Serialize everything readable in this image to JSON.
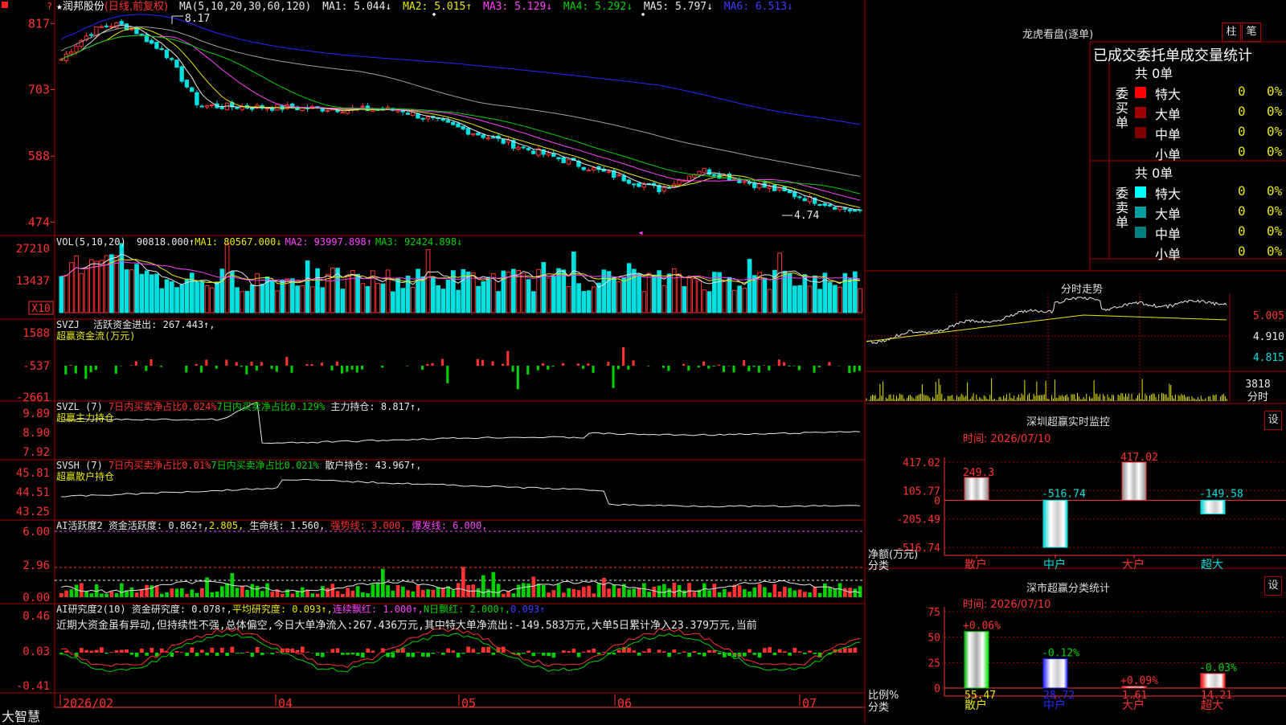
{
  "colors": {
    "up": "#ff3232",
    "down": "#00e0e0",
    "grid": "#a00000",
    "axis": "#ff3232",
    "white": "#e8e8e8",
    "yellow": "#e8e800",
    "magenta": "#ff40ff",
    "green": "#00d000",
    "gray": "#a0a0a0",
    "blue": "#2828ff"
  },
  "header": {
    "star": "★",
    "stock_name": "润邦股份",
    "period": "(日线,前复权)",
    "ma_label": "MA(5,10,20,30,60,120)",
    "ma1": "MA1: 5.044↓",
    "ma2": "MA2: 5.015↑",
    "ma3": "MA3: 5.129↓",
    "ma4": "MA4: 5.292↓",
    "ma5": "MA5: 5.797↓",
    "ma6": "MA6: 6.513↓"
  },
  "kline": {
    "yticks": [
      "817",
      "703",
      "588",
      "474"
    ],
    "high_label": "8.17",
    "low_label": "4.74",
    "top_left_mark": "?"
  },
  "vol": {
    "label": "VOL(5,10,20)",
    "value": "90818.000↑",
    "ma1": "MA1: 80567.000↓",
    "ma2": "MA2: 93997.898↑",
    "ma3": "MA3: 92424.898↓",
    "yticks": [
      "27210",
      "13437"
    ],
    "unit": "X10"
  },
  "svzj": {
    "label": "SVZJ",
    "name": "活跃资金进出: 267.443↑,",
    "sub": "超赢资金流(万元)",
    "yticks": [
      "1588",
      "-537",
      "-2661"
    ]
  },
  "svzl": {
    "label": "SVZL (7)",
    "t1": "7日内买卖净占比0.024%",
    "t2": "7日内买卖净占比0.129%",
    "t3": "主力持仓: 8.817↑,",
    "sub": "超赢主力持仓",
    "yticks": [
      "9.89",
      "8.90",
      "7.92"
    ]
  },
  "svsh": {
    "label": "SVSH (7)",
    "t1": "7日内买卖净占比0.01%",
    "t2": "7日内买卖净占比0.021%",
    "t3": "散户持仓: 43.967↑,",
    "sub": "超赢散户持仓",
    "yticks": [
      "45.81",
      "44.51",
      "43.25"
    ]
  },
  "ai1": {
    "label": "AI活跃度2",
    "t1": "资金活跃度: 0.862↑,",
    "t2": "2.805,",
    "t3": "生命线: 1.560,",
    "t4": "强势线: 3.000,",
    "t5": "爆发线: 6.000,",
    "yticks": [
      "6.00",
      "2.96",
      "0.00"
    ]
  },
  "ai2": {
    "label": "AI研究度2(10)",
    "t1": "资金研究度: 0.078↑,",
    "t2": "平均研究度: 0.093↑,",
    "t3": "连续飘红: 1.000↑,",
    "t4": "N日飘红: 2.000↑,",
    "t5": "0.093↑",
    "comment": "近期大资金虽有异动,但持续性不强,总体偏空,今日大单净流入:267.436万元,其中特大单净流出:-149.583万元,大单5日累计净入23.379万元,当前",
    "yticks": [
      "0.46",
      "0.03",
      "-0.41"
    ]
  },
  "xaxis": {
    "brand": "大智慧",
    "labels": [
      "2026/02",
      "04",
      "05",
      "06",
      "07"
    ]
  },
  "longhu": {
    "title": "龙虎看盘(逐单)",
    "btn1": "柱",
    "btn2": "笔",
    "subtitle": "已成交委托单成交量统计",
    "buy_label": "委买单",
    "sell_label": "委卖单",
    "buy_total": "共 0单",
    "sell_total": "共 0单",
    "buy_rows": [
      {
        "name": "特大",
        "val": "0",
        "pct": "0%",
        "color": "#ff0000"
      },
      {
        "name": "大单",
        "val": "0",
        "pct": "0%",
        "color": "#a00000"
      },
      {
        "name": "中单",
        "val": "0",
        "pct": "0%",
        "color": "#800000"
      },
      {
        "name": "小单",
        "val": "0",
        "pct": "0%",
        "color": ""
      }
    ],
    "sell_rows": [
      {
        "name": "特大",
        "val": "0",
        "pct": "0%",
        "color": "#00ffff"
      },
      {
        "name": "大单",
        "val": "0",
        "pct": "0%",
        "color": "#00a0a0"
      },
      {
        "name": "中单",
        "val": "0",
        "pct": "0%",
        "color": "#008080"
      },
      {
        "name": "小单",
        "val": "0",
        "pct": "0%",
        "color": ""
      }
    ]
  },
  "fenshi": {
    "title": "分时走势",
    "yticks": [
      "5.005",
      "4.910",
      "4.815"
    ],
    "vol_label": "3818",
    "vol_unit": "分时"
  },
  "sz_monitor": {
    "title": "深圳超赢实时监控",
    "btn": "设",
    "time": "时间: 2026/07/10",
    "ylabel1": "净额(万元)",
    "ylabel2": "分类",
    "yticks": [
      "417.02",
      "105.77",
      "0",
      "-205.49",
      "-516.74"
    ]
  },
  "sz_class": {
    "title": "深市超赢分类统计",
    "btn": "设",
    "time": "时间: 2026/07/10",
    "ylabel1": "比例%",
    "ylabel2": "分类",
    "yticks": [
      "75",
      "50",
      "25",
      "0"
    ]
  },
  "chart_data": [
    {
      "type": "bar",
      "title": "深圳超赢实时监控",
      "categories": [
        "散户",
        "中户",
        "大户",
        "超大"
      ],
      "values": [
        249.3,
        -516.74,
        417.02,
        -149.58
      ],
      "value_labels": [
        "249.3",
        "-516.74",
        "417.02",
        "-149.58"
      ],
      "ylabel": "净额(万元)",
      "xlabel": "分类",
      "ylim": [
        -516.74,
        417.02
      ]
    },
    {
      "type": "bar",
      "title": "深市超赢分类统计",
      "categories": [
        "散户",
        "中户",
        "大户",
        "超大"
      ],
      "values": [
        55.47,
        28.72,
        1.61,
        14.21
      ],
      "value_labels": [
        "55.47",
        "28.72",
        "1.61",
        "14.21"
      ],
      "changes": [
        "+0.06%",
        "-0.12%",
        "+0.09%",
        "-0.03%"
      ],
      "ylabel": "比例%",
      "xlabel": "分类",
      "ylim": [
        0,
        75
      ]
    }
  ]
}
